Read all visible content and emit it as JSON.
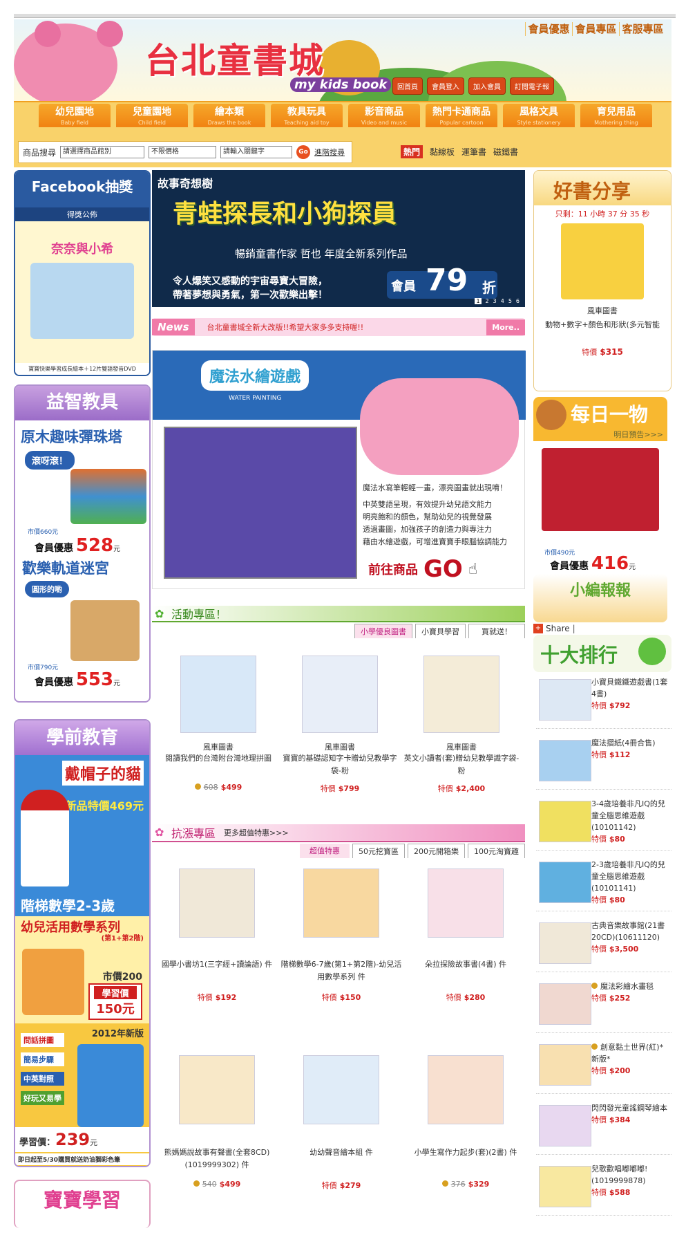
{
  "header": {
    "logo_cn": "台北童書城",
    "logo_en": "my kids book",
    "top_links": [
      "會員優惠",
      "會員專區",
      "客服專區"
    ],
    "buttons": [
      "回首頁",
      "會員登入",
      "加入會員",
      "訂閱電子報"
    ]
  },
  "nav": [
    {
      "label": "幼兒園地",
      "sub": "Baby field"
    },
    {
      "label": "兒童園地",
      "sub": "Child field"
    },
    {
      "label": "繪本類",
      "sub": "Draws the book"
    },
    {
      "label": "教具玩具",
      "sub": "Teaching aid toy"
    },
    {
      "label": "影音商品",
      "sub": "Video and music"
    },
    {
      "label": "熱門卡通商品",
      "sub": "Popular cartoon"
    },
    {
      "label": "風格文具",
      "sub": "Style stationery"
    },
    {
      "label": "育兒用品",
      "sub": "Mothering thing"
    }
  ],
  "search": {
    "label": "商品搜尋",
    "category": "請選擇商品館別",
    "price": "不限價格",
    "keyword": "請輸入關鍵字",
    "go": "Go",
    "advanced": "進階搜尋",
    "hot": "熱門",
    "hot_terms": [
      "黏線板",
      "運筆書",
      "磁鐵書"
    ]
  },
  "left": {
    "facebook": {
      "title": "Facebook抽獎",
      "sub": "得獎公佈",
      "caption": "奈奈與小希",
      "footer": "寶寶快樂學習成長繪本＋12片雙語發音DVD"
    },
    "edu": {
      "title": "益智教具",
      "item1": "原木趣味彈珠塔",
      "bubble1": "滾呀滾！",
      "list1": "市價660元",
      "member1": "會員優惠",
      "price1": "528",
      "unit": "元",
      "item2": "歡樂軌道迷宮",
      "bubble2": "圓形的喲",
      "list2": "市價790元",
      "member2": "會員優惠",
      "price2": "553"
    },
    "preschool": {
      "title": "學前教育",
      "cat_title": "戴帽子的貓",
      "cat_price": "新品特價469元",
      "math_title": "階梯數學2-3歲",
      "math_series": "幼兒活用數學系列",
      "math_sub": "(第1+第2階)",
      "math_list": "市價200",
      "math_learn": "學習價",
      "math_price": "150元",
      "car_year": "2012年新版",
      "car_tags": [
        "問話拼圖",
        "簡易步驟",
        "中英對照",
        "好玩又易學"
      ],
      "car_learn": "學習價：",
      "car_price": "239",
      "car_note": "即日起至5/30購買就送奶油獅彩色筆"
    },
    "learn": {
      "title": "寶寶學習"
    }
  },
  "banner": {
    "brand": "故事奇想樹",
    "title": "青蛙探長和小狗探員",
    "subtitle": "暢銷童書作家 哲也 年度全新系列作品",
    "desc1": "令人爆笑又感動的宇宙尋寶大冒險，",
    "desc2": "帶著夢想與勇氣，第一次歡樂出擊！",
    "member_label": "會員",
    "discount": "79",
    "discount_unit": "折",
    "pages": [
      "1",
      "2",
      "3",
      "4",
      "5",
      "6"
    ]
  },
  "news": {
    "label": "News",
    "text": "台北童書城全新大改版!!希望大家多多支持喔!!",
    "more": "More.."
  },
  "promo": {
    "title": "魔法水繪遊戲",
    "title_en": "WATER PAINTING",
    "line1": "魔法水寫筆輕輕一畫，漂亮圖畫就出現唷！",
    "line2": "中英雙語呈現，有效提升幼兒語文能力",
    "line3": "明亮飽和的顏色，幫助幼兒的視覺發展",
    "line4": "透過畫圖，加強孩子的創造力與專注力",
    "line5": "藉由水繪遊戲，可增進寶寶手眼腦協調能力",
    "go_label": "前往商品",
    "go": "GO"
  },
  "activity": {
    "title": "活動專區！",
    "tabs": [
      "小學優良圖書",
      "小寶貝學習",
      "買就送！"
    ],
    "products": [
      {
        "pub": "風車圖書",
        "name": "閱讀我們的台灣附台灣地理拼圖",
        "old": "608",
        "price": "$499"
      },
      {
        "pub": "風車圖書",
        "name": "寶寶的基礎認知字卡贈幼兒教學字袋-粉",
        "label": "特價",
        "price": "$799"
      },
      {
        "pub": "風車圖書",
        "name": "英文小讀者(套)贈幼兒教學識字袋-粉",
        "label": "特價",
        "price": "$2,400"
      }
    ]
  },
  "deal": {
    "title": "抗漲專區",
    "more": "更多超值特惠>>>",
    "tabs": [
      "超值特惠",
      "50元挖寶區",
      "200元開箱樂",
      "100元淘寶趣"
    ],
    "products": [
      {
        "name": "國學小書坊1(三字經+讀論語) 件",
        "label": "特價",
        "price": "$192"
      },
      {
        "name": "階梯數學6-7歲(第1+第2階)-幼兒活用數學系列 件",
        "label": "特價",
        "price": "$150"
      },
      {
        "name": "朵拉探險故事書(4書) 件",
        "label": "特價",
        "price": "$280"
      },
      {
        "name": "熊媽媽說故事有聲書(全套8CD)(1019999302) 件",
        "old": "540",
        "price": "$499"
      },
      {
        "name": "幼幼聲音繪本組 件",
        "label": "特價",
        "price": "$279"
      },
      {
        "name": "小學生寫作力起步(套)(2書) 件",
        "old": "376",
        "price": "$329"
      }
    ]
  },
  "right": {
    "good": {
      "title": "好書分享",
      "countdown": "只剩：11 小時 37 分 35 秒",
      "pub": "風車圖書",
      "name": "動物+數字+顏色和形狀(多元智能",
      "label": "特價",
      "price": "$315"
    },
    "daily": {
      "title": "每日一物",
      "preview": "明日預告>>>",
      "list": "市價490元",
      "member": "會員優惠",
      "price": "416",
      "unit": "元"
    },
    "report": {
      "title": "小編報報",
      "share": "Share"
    },
    "top10": {
      "title": "十大排行",
      "items": [
        {
          "name": "小寶貝鐵鐵遊戲書(1套4書)",
          "label": "特價",
          "price": "$792"
        },
        {
          "name": "魔法摺紙(4冊合售)",
          "label": "特價",
          "price": "$112"
        },
        {
          "name": "3-4歲培養非凡IQ的兒童全腦思維遊戲(10101142)",
          "label": "特價",
          "price": "$80"
        },
        {
          "name": "2-3歲培養非凡IQ的兒童全腦思維遊戲(10101141)",
          "label": "特價",
          "price": "$80"
        },
        {
          "name": "古典音樂故事館(21書20CD)(10611120)",
          "label": "特價",
          "price": "$3,500"
        },
        {
          "name": "魔法彩繪水畫毯",
          "label": "特價",
          "price": "$252"
        },
        {
          "name": "創意黏土世界(紅)*新版*",
          "label": "特價",
          "price": "$200"
        },
        {
          "name": "閃閃發光童謠鋼琴繪本",
          "label": "特價",
          "price": "$384"
        },
        {
          "name": "兒歌歡唱嘟嘟嘟!(1019999878)",
          "label": "特價",
          "price": "$588"
        }
      ]
    }
  }
}
